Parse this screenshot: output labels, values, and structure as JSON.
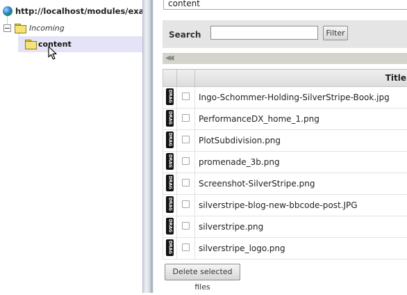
{
  "tree": {
    "root_label": "http://localhost/modules/examples",
    "incoming_label": "Incoming",
    "content_label": "content"
  },
  "panel": {
    "current_folder_tab": "content"
  },
  "search": {
    "label": "Search",
    "value": "",
    "placeholder": "",
    "filter_label": "Filter"
  },
  "pager": {
    "first_icon": "first-page-icon"
  },
  "table": {
    "column_title": "Title",
    "drag_label": "DRAG",
    "files": [
      "Ingo-Schommer-Holding-SilverStripe-Book.jpg",
      "PerformanceDX_home_1.png",
      "PlotSubdivision.png",
      "promenade_3b.png",
      "Screenshot-SilverStripe.png",
      "silverstripe-blog-new-bbcode-post.JPG",
      "silverstripe.png",
      "silverstripe_logo.png"
    ]
  },
  "actions": {
    "delete_label": "Delete selected files"
  },
  "colors": {
    "selected_row": "#e4e4f6",
    "search_bar": "#e5e5e5",
    "pager_bar": "#d4d4cc",
    "drag_handle": "#111111"
  }
}
